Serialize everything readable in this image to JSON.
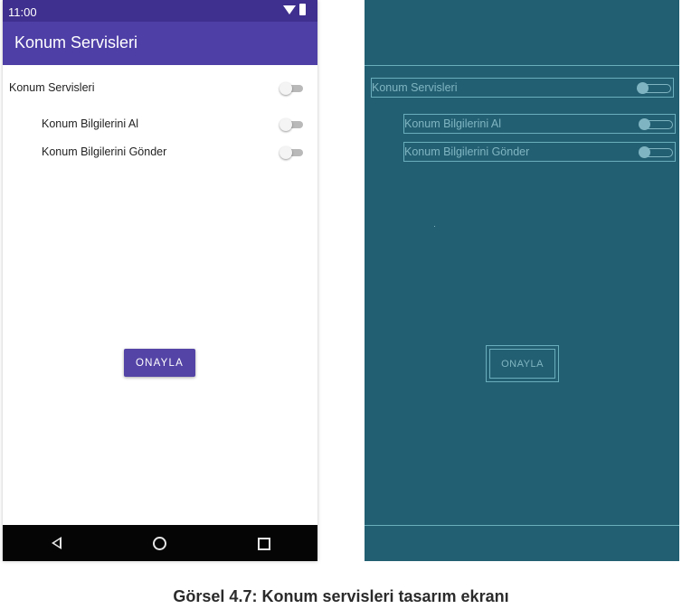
{
  "status_bar": {
    "time": "11:00",
    "icons": [
      "wifi-icon",
      "battery-icon"
    ]
  },
  "app_bar": {
    "title": "Konum Servisleri"
  },
  "settings": {
    "main": {
      "label": "Konum Servisleri",
      "checked": false
    },
    "items": [
      {
        "label": "Konum Bilgilerini Al",
        "checked": false
      },
      {
        "label": "Konum Bilgilerini Gönder",
        "checked": false
      }
    ]
  },
  "confirm_button": {
    "label": "ONAYLA"
  },
  "nav_bar": {
    "icons": [
      "back-icon",
      "home-icon",
      "recent-apps-icon"
    ]
  },
  "blueprint": {
    "main_label": "Konum Servisleri",
    "items": [
      "Konum Bilgilerini Al",
      "Konum Bilgilerini Gönder"
    ],
    "button_label": "ONAYLA"
  },
  "caption": "Görsel 4.7: Konum servisleri tasarım ekranı",
  "colors": {
    "status_bar": "#3f2f8e",
    "app_bar": "#4e3fa6",
    "button": "#5444a6",
    "nav_bar": "#050505",
    "blueprint_bg": "#235f72",
    "blueprint_line": "#6aaebc"
  }
}
